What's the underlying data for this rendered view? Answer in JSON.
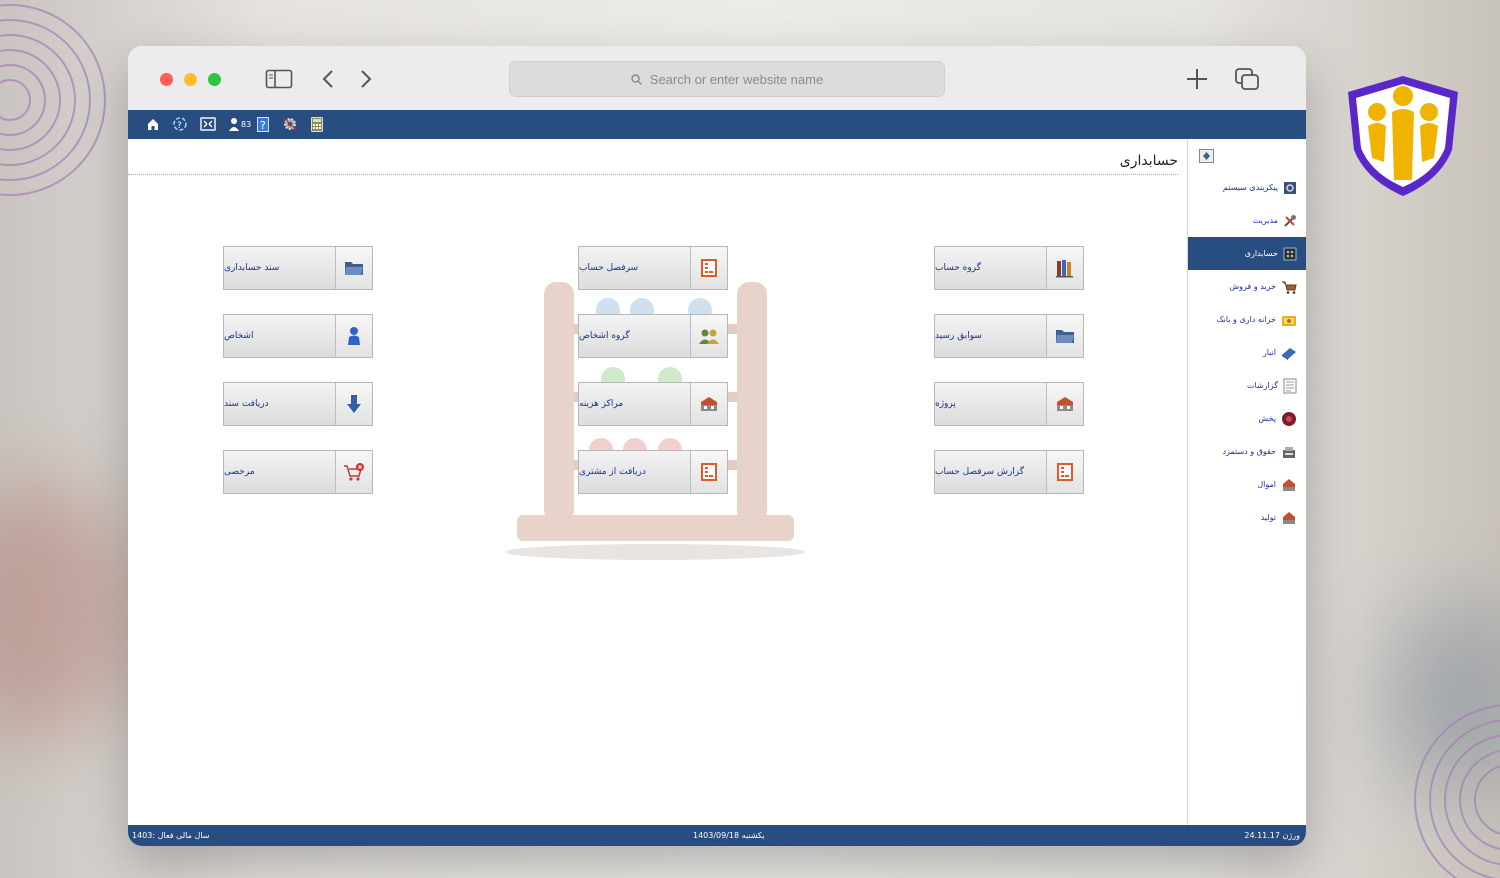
{
  "browser": {
    "address_placeholder": "Search or enter website name"
  },
  "toolbar": {
    "user_count": "83"
  },
  "page": {
    "title": "حسابداری"
  },
  "tiles": {
    "right_col": [
      "گروه حساب",
      "سوابق رسید",
      "پروژه",
      "گزارش سرفصل حساب"
    ],
    "middle_col": [
      "سرفصل حساب",
      "گروه اشخاص",
      "مراکز هزینه",
      "دریافت از مشتری"
    ],
    "left_col": [
      "سند حسابداری",
      "اشخاص",
      "دریافت سند",
      "مرخصی"
    ]
  },
  "sidebar": {
    "items": [
      {
        "label": "پیکربندی سیستم",
        "icon": "system-config-icon"
      },
      {
        "label": "مدیریت",
        "icon": "management-icon"
      },
      {
        "label": "حسابداری",
        "icon": "accounting-icon",
        "active": true
      },
      {
        "label": "خرید و فروش",
        "icon": "cart-icon"
      },
      {
        "label": "خزانه داری و بانک",
        "icon": "treasury-icon"
      },
      {
        "label": "انبار",
        "icon": "warehouse-icon"
      },
      {
        "label": "گزارشات",
        "icon": "reports-icon"
      },
      {
        "label": "پخش",
        "icon": "distribution-icon"
      },
      {
        "label": "حقوق و دستمزد",
        "icon": "payroll-icon"
      },
      {
        "label": "اموال",
        "icon": "assets-icon"
      },
      {
        "label": "تولید",
        "icon": "production-icon"
      }
    ]
  },
  "status": {
    "fiscal_year": "سال مالی فعال :1403",
    "date": "یکشنبه 1403/09/18",
    "version": "ورژن 24.11.17"
  },
  "colors": {
    "appbar": "#284d80",
    "link_text": "#1b2e9c",
    "active_item": "#284d80"
  }
}
